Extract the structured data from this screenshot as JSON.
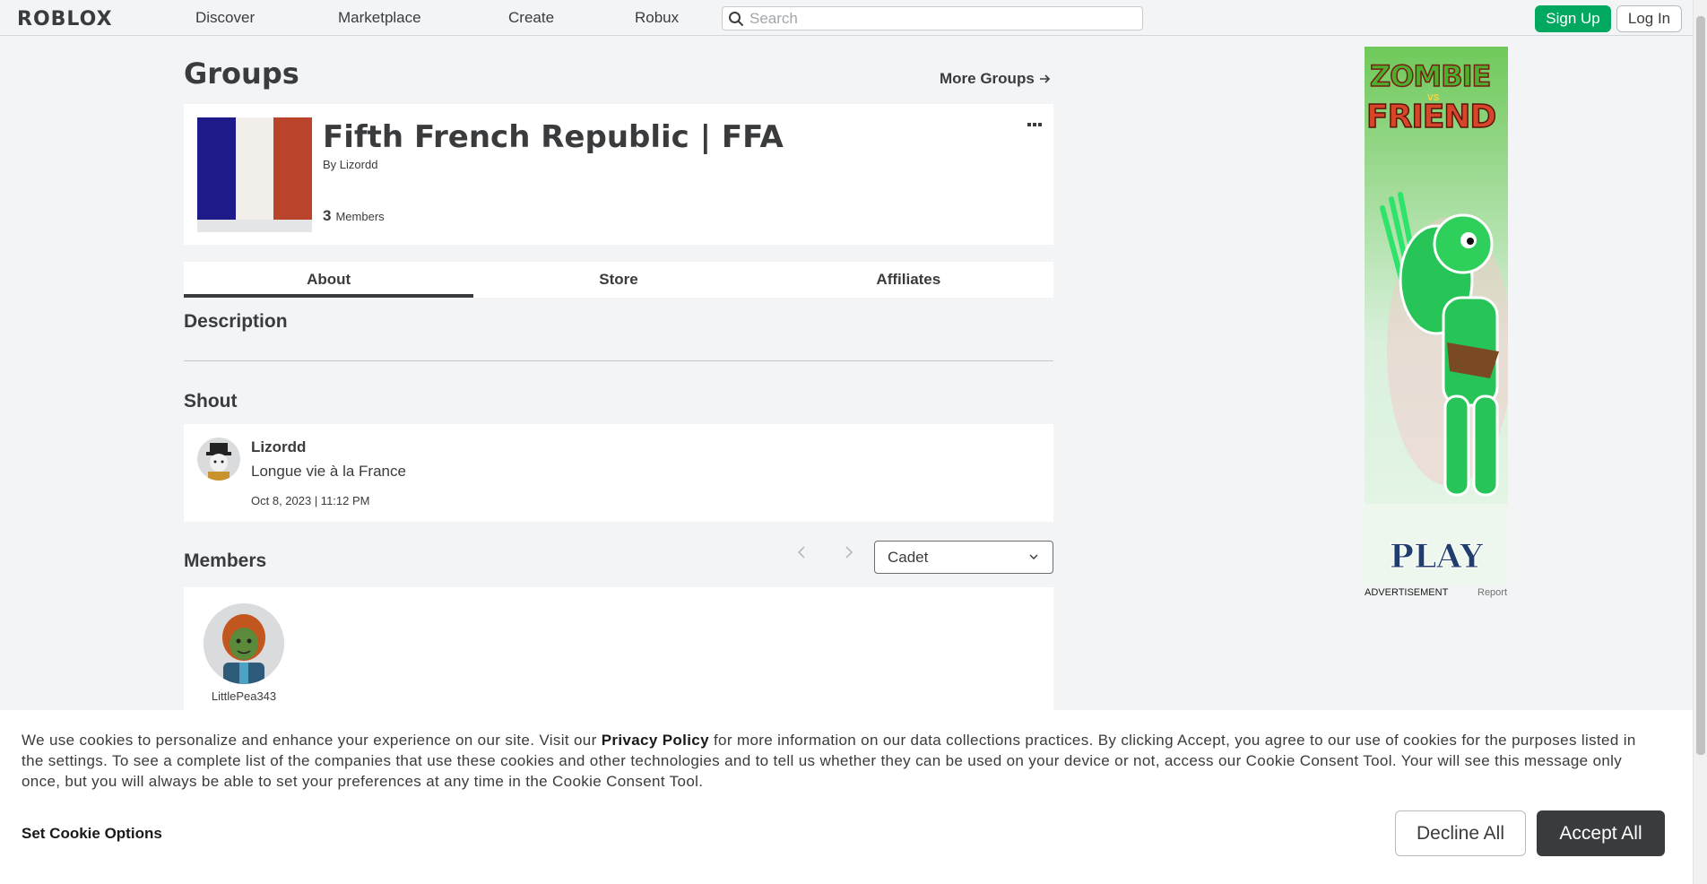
{
  "header": {
    "logo": "ROBLOX",
    "nav": [
      "Discover",
      "Marketplace",
      "Create",
      "Robux"
    ],
    "search_placeholder": "Search",
    "signup_label": "Sign Up",
    "login_label": "Log In"
  },
  "page": {
    "title": "Groups",
    "more_groups": "More Groups",
    "more_groups_icon": "arrow-right-icon"
  },
  "group": {
    "name": "Fifth French Republic | FFA",
    "by_prefix": "By",
    "owner": "Lizordd",
    "member_count": "3",
    "members_label": "Members",
    "flag_colors": [
      "#1f1a8a",
      "#f2eeea",
      "#b9432b"
    ],
    "more_icon": "ellipsis-icon"
  },
  "tabs": [
    "About",
    "Store",
    "Affiliates"
  ],
  "active_tab": "About",
  "about": {
    "description_title": "Description",
    "shout_title": "Shout",
    "shout": {
      "user": "Lizordd",
      "text": "Longue vie à la France",
      "date": "Oct 8, 2023 | 11:12 PM"
    },
    "members_title": "Members",
    "rank_selected": "Cadet",
    "members": [
      {
        "name": "LittlePea343"
      }
    ]
  },
  "ad": {
    "title_line1": "ZOMBIE",
    "title_vs": "VS",
    "title_line2": "FRIEND",
    "cta": "PLAY",
    "label": "ADVERTISEMENT",
    "report": "Report"
  },
  "cookie": {
    "text_before": "We use cookies to personalize and enhance your experience on our site. Visit our ",
    "privacy_link": "Privacy Policy",
    "text_after": " for more information on our data collections practices. By clicking Accept, you agree to our use of cookies for the purposes listed in the settings. To see a complete list of the companies that use these cookies and other technologies and to tell us whether they can be used on your device or not, access our Cookie Consent Tool. Your will see this message only once, but you will always be able to set your preferences at any time in the Cookie Consent Tool.",
    "options_label": "Set Cookie Options",
    "decline_label": "Decline All",
    "accept_label": "Accept All"
  },
  "colors": {
    "signup_green": "#00a860",
    "text_dark": "#393b3d",
    "background": "#f2f4f5"
  }
}
